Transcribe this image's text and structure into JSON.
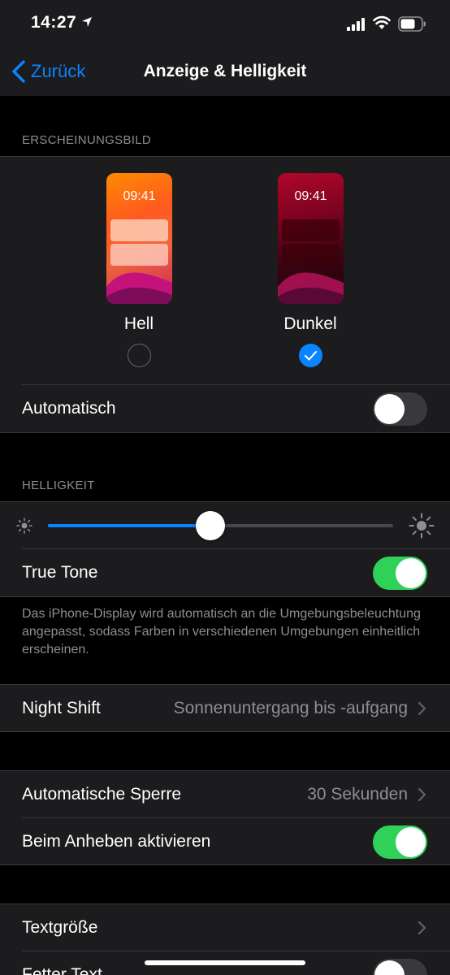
{
  "status_bar": {
    "time": "14:27"
  },
  "nav": {
    "back_label": "Zurück",
    "title": "Anzeige & Helligkeit"
  },
  "appearance": {
    "header": "ERSCHEINUNGSBILD",
    "light": {
      "preview_time": "09:41",
      "label": "Hell",
      "selected": false
    },
    "dark": {
      "preview_time": "09:41",
      "label": "Dunkel",
      "selected": true
    },
    "automatic": {
      "label": "Automatisch",
      "on": false
    }
  },
  "brightness": {
    "header": "HELLIGKEIT",
    "slider_value": 0.47,
    "true_tone": {
      "label": "True Tone",
      "on": true
    },
    "footer": "Das iPhone-Display wird automatisch an die Umgebungsbeleuchtung angepasst, sodass Farben in verschiedenen Umgebungen einheitlich erscheinen."
  },
  "night_shift": {
    "label": "Night Shift",
    "value": "Sonnenuntergang bis -aufgang"
  },
  "lock": {
    "auto_lock": {
      "label": "Automatische Sperre",
      "value": "30 Sekunden"
    },
    "raise_to_wake": {
      "label": "Beim Anheben aktivieren",
      "on": true
    }
  },
  "text": {
    "text_size": {
      "label": "Textgröße"
    },
    "bold_text": {
      "label": "Fetter Text",
      "on": false
    }
  },
  "colors": {
    "accent": "#0a84ff",
    "toggle_on": "#30d158",
    "toggle_off": "#39393d",
    "group_bg": "#1c1c1e",
    "secondary_text": "#8e8e93"
  }
}
